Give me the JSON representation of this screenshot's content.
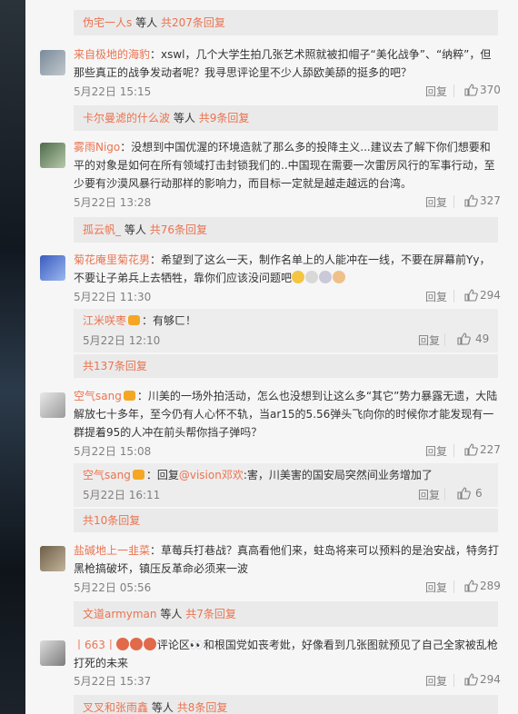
{
  "threads": [
    {
      "sub": {
        "name": "伪宅一人s",
        "mid": "等人",
        "count": "共207条回复"
      }
    },
    {
      "user": "来自极地的海豹",
      "text": "：xswl，几个大学生拍几张艺术照就被扣帽子“美化战争”、“纳粹”，但那些真正的战争发动者呢？我寻思评论里不少人舔欧美舔的挺多的吧？",
      "date": "5月22日 15:15",
      "reply": "回复",
      "likes": "370",
      "sub": {
        "name": "卡尔曼滤的什么波",
        "mid": "等人",
        "count": "共9条回复"
      }
    },
    {
      "user": "雾雨Nigo",
      "text": "：没想到中国优渥的环境造就了那么多的投降主义...建议去了解下你们想要和平的对象是如何在所有领域打击封锁我们的..中国现在需要一次雷厉风行的军事行动，至少要有沙漠风暴行动那样的影响力，而目标一定就是越走越远的台湾。",
      "date": "5月22日 13:28",
      "reply": "回复",
      "likes": "327",
      "sub": {
        "name": "孤云帆_",
        "mid": "等人",
        "count": "共76条回复"
      }
    },
    {
      "user": "菊花庵里菊花男",
      "text": "：希望到了这么一天，制作名单上的人能冲在一线，不要在屏幕前Yy，不要让子弟兵上去牺牲，靠你们应该没问题吧",
      "date": "5月22日 11:30",
      "reply": "回复",
      "likes": "294",
      "nested": {
        "user": "江米咲枣",
        "text": "：有够ㄈ！",
        "date": "5月22日 12:10",
        "reply": "回复",
        "likes": "49"
      },
      "more": "共137条回复"
    },
    {
      "user": "空气sang",
      "text": "：川美的一场外拍活动，怎么也没想到让这么多“其它”势力暴露无遗，大陆解放七十多年，至今仍有人心怀不轨，当ar15的5.56弹头飞向你的时候你才能发现有一群提着95的人冲在前头帮你挡子弹吗？",
      "date": "5月22日 15:08",
      "reply": "回复",
      "likes": "227",
      "nested": {
        "user": "空气sang",
        "pre": "：回复",
        "at": "@vision邓欢",
        "text": ":害，川美害的国安局突然间业务增加了",
        "date": "5月22日 16:11",
        "reply": "回复",
        "likes": "6"
      },
      "more": "共10条回复"
    },
    {
      "user": "盐碱地上一韭菜",
      "text": "：草莓兵打巷战？真高看他们来，蛀岛将来可以预料的是治安战，特务打黑枪搞破坏，镇压反革命必须来一波",
      "date": "5月22日 05:56",
      "reply": "回复",
      "likes": "289",
      "sub": {
        "name": "文道armyman",
        "mid": "等人",
        "count": "共7条回复"
      }
    },
    {
      "user": "丨663丨",
      "text": "评论区👀和根国党如丧考妣，好像看到几张图就预见了自己全家被乱枪打死的未来",
      "date": "5月22日 15:37",
      "reply": "回复",
      "likes": "294",
      "sub": {
        "name": "叉叉和张雨鑫",
        "mid": "等人",
        "count": "共8条回复"
      }
    }
  ],
  "colors": {
    "accent": "#eb7350",
    "muted": "#808080",
    "panel": "#f6f6f6",
    "subbg": "#eaeaea"
  },
  "icons": {
    "like": "thumbs-up-icon",
    "badge": "vip-badge-icon",
    "avatar": "user-avatar"
  }
}
